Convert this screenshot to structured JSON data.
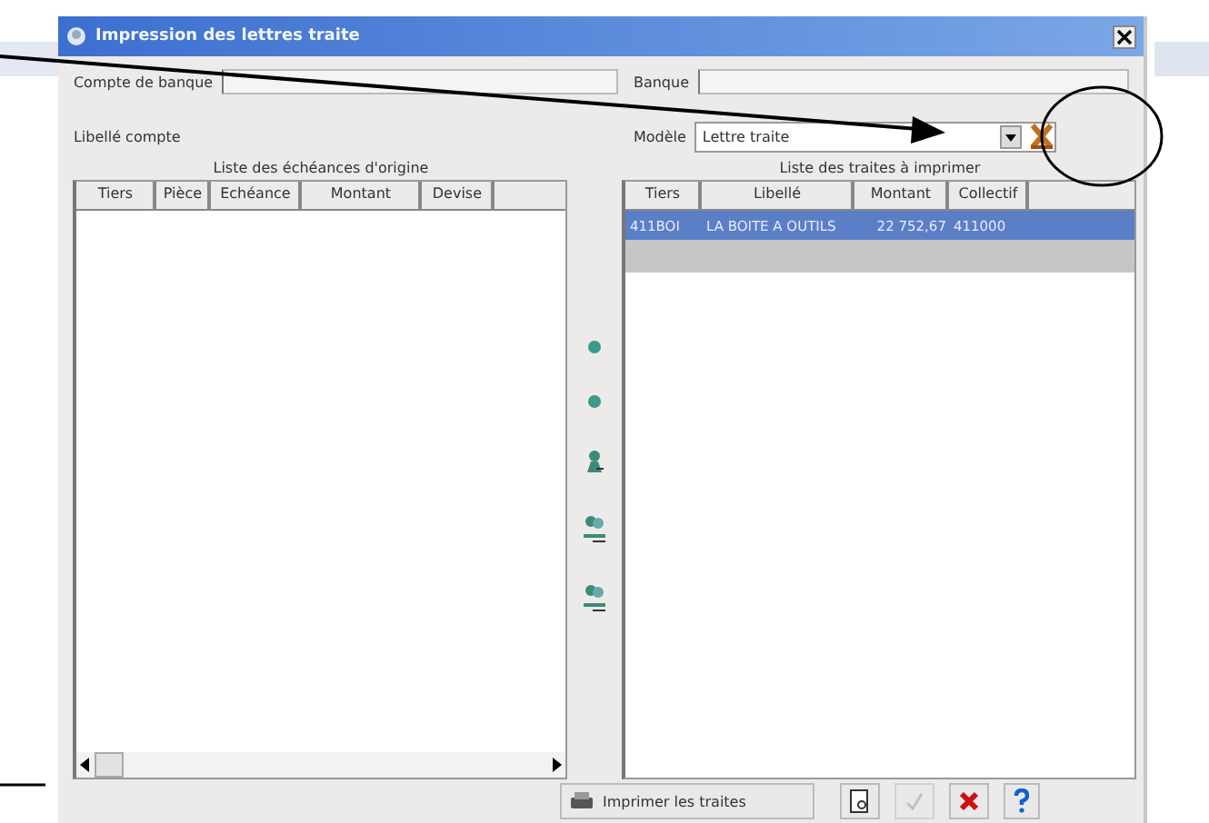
{
  "window": {
    "title": "Impression des lettres traite"
  },
  "fields": [
    {
      "kind": "text",
      "label": "Compte de banque"
    },
    {
      "kind": "text",
      "label": "Banque"
    },
    {
      "kind": "label",
      "label": "Libellé compte"
    },
    {
      "kind": "combo",
      "label": "Modèle",
      "value": "Lettre traite"
    }
  ],
  "source_list": {
    "title": "Liste des échéances d'origine",
    "columns": [
      "Tiers",
      "Pièce",
      "Echéance",
      "Montant",
      "Devise"
    ]
  },
  "transfer_buttons": [
    {
      "kind": "dot"
    },
    {
      "kind": "dot"
    },
    {
      "kind": "single"
    },
    {
      "kind": "double"
    },
    {
      "kind": "double"
    }
  ],
  "target_list": {
    "title": "Liste des traites à imprimer",
    "columns": [
      "Tiers",
      "Libellé",
      "Montant",
      "Collectif"
    ],
    "rows": [
      {
        "cells": [
          "411BOI",
          "LA BOITE A OUTILS",
          "22 752,67",
          "411000"
        ],
        "selected": true
      }
    ]
  },
  "buttons": [
    {
      "kind": "print",
      "label": "Imprimer les traites",
      "disabled": false
    },
    {
      "kind": "preview",
      "disabled": false
    },
    {
      "kind": "ok",
      "disabled": true
    },
    {
      "kind": "cancel",
      "disabled": false
    },
    {
      "kind": "help",
      "disabled": false
    }
  ]
}
